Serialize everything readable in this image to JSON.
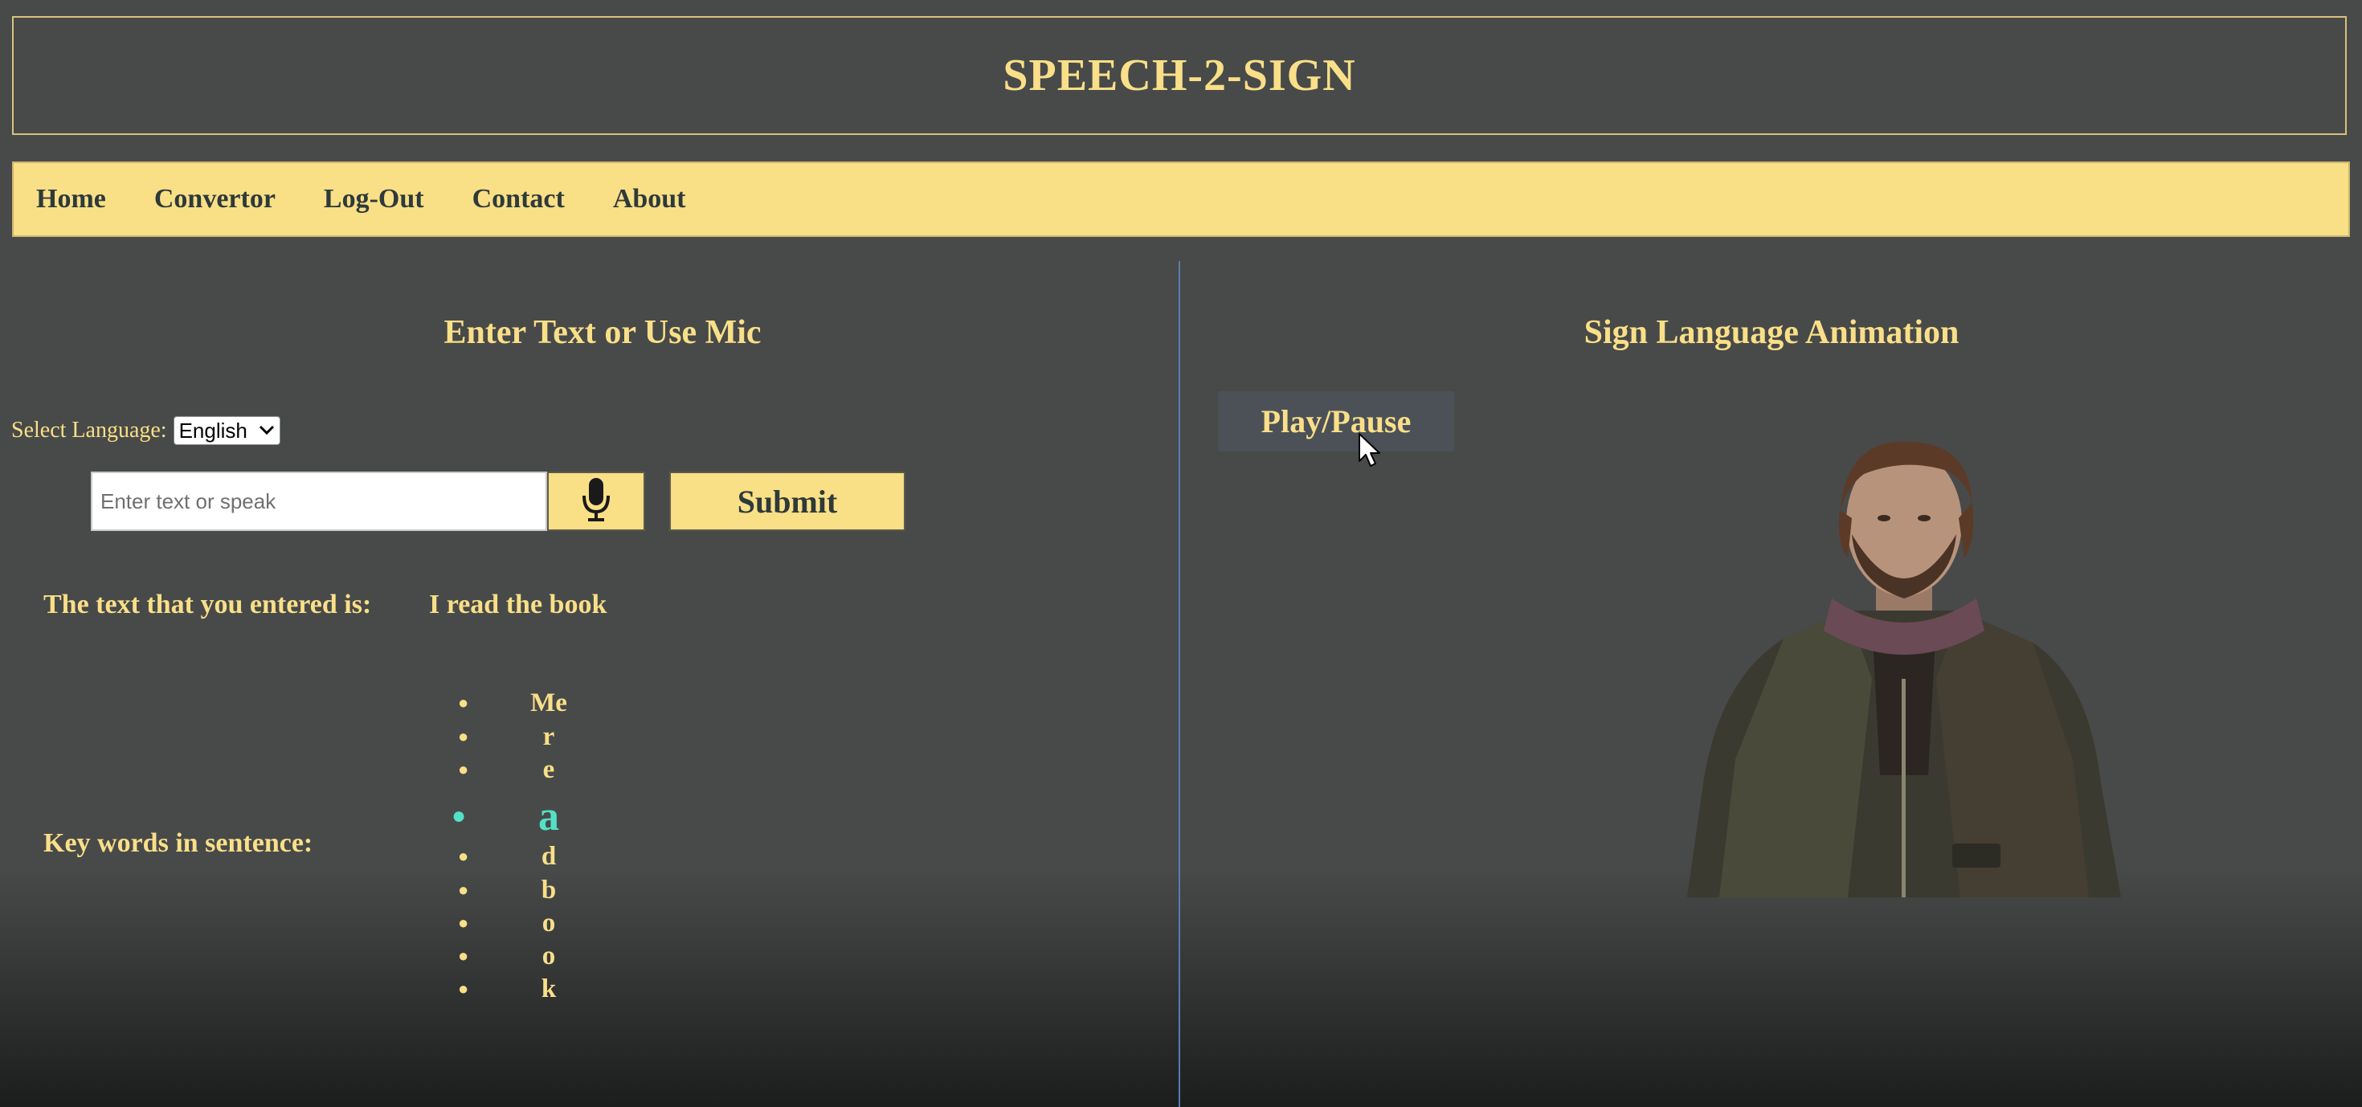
{
  "header": {
    "title": "SPEECH-2-SIGN"
  },
  "nav": {
    "items": [
      "Home",
      "Convertor",
      "Log-Out",
      "Contact",
      "About"
    ]
  },
  "left_panel": {
    "title": "Enter Text or Use Mic",
    "language_label": "Select Language:",
    "language_value": "English",
    "input_placeholder": "Enter text or speak",
    "input_value": "",
    "submit_label": "Submit",
    "entered_label": "The text that you entered is:",
    "entered_value": "I read the book",
    "keywords_label": "Key words in sentence:",
    "keywords": [
      "Me",
      "r",
      "e",
      "a",
      "d",
      "b",
      "o",
      "o",
      "k"
    ],
    "active_keyword_index": 3
  },
  "right_panel": {
    "title": "Sign Language Animation",
    "play_pause_label": "Play/Pause"
  },
  "colors": {
    "background": "#484a49",
    "accent_yellow": "#f9df86",
    "nav_text": "#2e3a3a",
    "active_keyword": "#54e0c6",
    "divider": "#5a7ab0"
  },
  "icons": {
    "mic_button": "microphone-icon",
    "language_select": "chevron-down-icon"
  }
}
